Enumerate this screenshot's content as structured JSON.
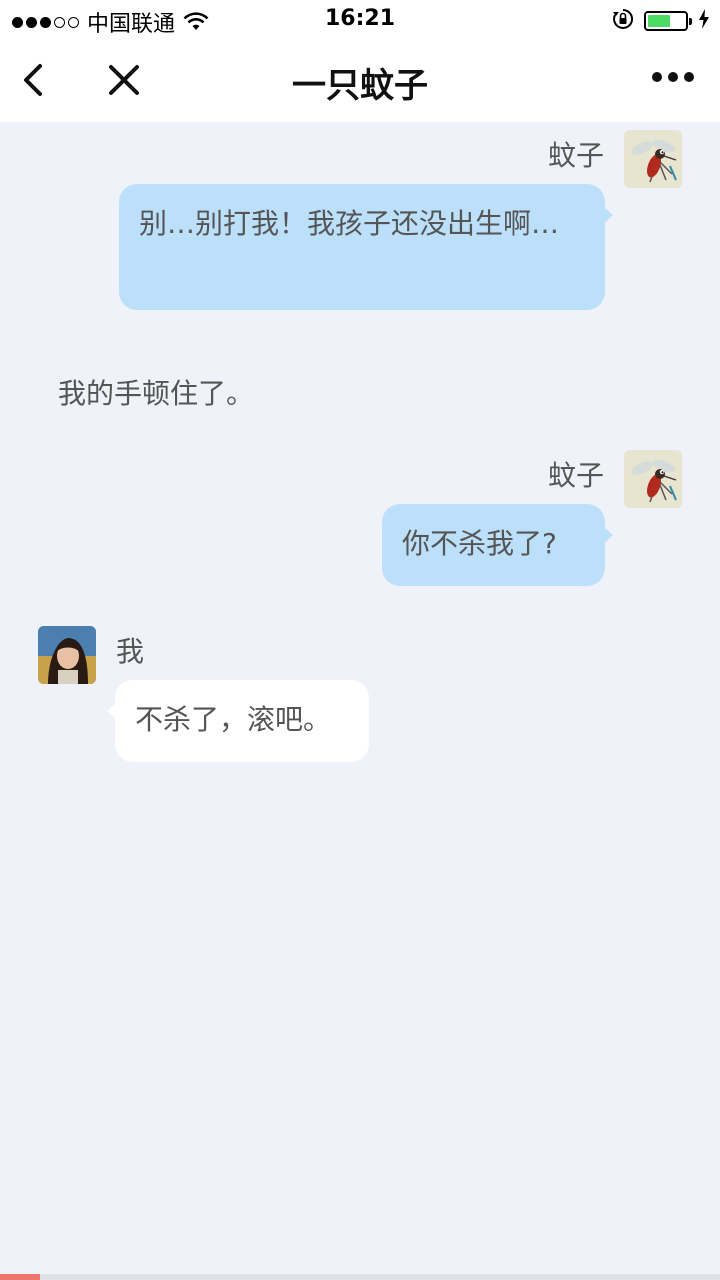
{
  "status_bar": {
    "signal_filled": 3,
    "signal_total": 5,
    "carrier": "中国联通",
    "time": "16:21",
    "battery_level": 0.6,
    "battery_color": "#4cd964"
  },
  "nav": {
    "title": "一只蚊子",
    "back_icon": "chevron-left-icon",
    "close_icon": "close-icon",
    "more_icon": "more-dots-icon"
  },
  "messages": [
    {
      "type": "right",
      "sender": "蚊子",
      "avatar": "mosquito-avatar",
      "text": "别…别打我！我孩子还没出生啊…"
    },
    {
      "type": "narration",
      "text": "我的手顿住了。"
    },
    {
      "type": "right",
      "sender": "蚊子",
      "avatar": "mosquito-avatar",
      "text": "你不杀我了?"
    },
    {
      "type": "left",
      "sender": "我",
      "avatar": "user-avatar",
      "text": "不杀了，滚吧。"
    }
  ],
  "progress": {
    "value": 0.055,
    "color": "#f0756a"
  },
  "colors": {
    "background": "#eff2f8",
    "bubble_right": "#bcdffa",
    "bubble_left": "#ffffff"
  }
}
